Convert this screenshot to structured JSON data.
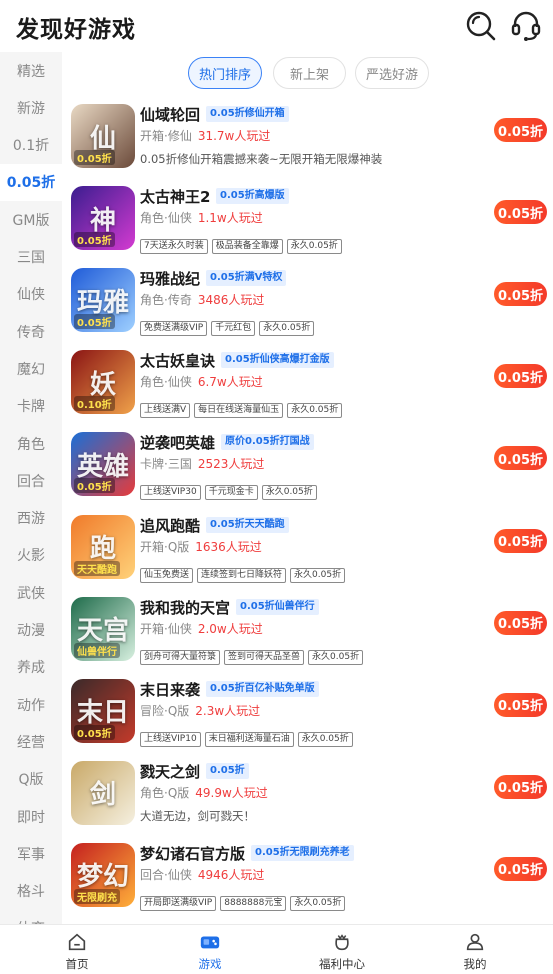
{
  "header": {
    "title": "发现好游戏",
    "search_icon": "search-icon",
    "service_icon": "headset-icon"
  },
  "sidebar": {
    "active_color": "#1e6fe8",
    "items": [
      {
        "label": "精选"
      },
      {
        "label": "新游"
      },
      {
        "label": "0.1折"
      },
      {
        "label": "0.05折",
        "active": true
      },
      {
        "label": "GM版"
      },
      {
        "label": "三国"
      },
      {
        "label": "仙侠"
      },
      {
        "label": "传奇"
      },
      {
        "label": "魔幻"
      },
      {
        "label": "卡牌"
      },
      {
        "label": "角色"
      },
      {
        "label": "回合"
      },
      {
        "label": "西游"
      },
      {
        "label": "火影"
      },
      {
        "label": "武侠"
      },
      {
        "label": "动漫"
      },
      {
        "label": "养成"
      },
      {
        "label": "动作"
      },
      {
        "label": "经营"
      },
      {
        "label": "Q版"
      },
      {
        "label": "即时"
      },
      {
        "label": "军事"
      },
      {
        "label": "格斗"
      },
      {
        "label": "体育"
      }
    ]
  },
  "tabs": [
    {
      "label": "热门排序",
      "active": true
    },
    {
      "label": "新上架"
    },
    {
      "label": "严选好游"
    }
  ],
  "games": [
    {
      "name": "仙域轮回",
      "badge": "0.05折修仙开箱",
      "genre": "开箱·修仙",
      "players": "31.7w人玩过",
      "desc": "0.05折修仙开箱震撼来袭~无限开箱无限爆神装",
      "chips": [],
      "discount": "0.05折",
      "icon_text": "仙",
      "icon_tag": "0.05折",
      "icon_colors": [
        "#e9d9c4",
        "#6b4a3a"
      ]
    },
    {
      "name": "太古神王2",
      "badge": "0.05折高爆版",
      "genre": "角色·仙侠",
      "players": "1.1w人玩过",
      "desc": "",
      "chips": [
        "7天送永久时装",
        "极品装备全靠爆",
        "永久0.05折"
      ],
      "discount": "0.05折",
      "icon_text": "神",
      "icon_tag": "0.05折",
      "icon_colors": [
        "#3a1d8f",
        "#d43bd1"
      ]
    },
    {
      "name": "玛雅战纪",
      "badge": "0.05折满V特权",
      "genre": "角色·传奇",
      "players": "3486人玩过",
      "desc": "",
      "chips": [
        "免费送满级VIP",
        "千元红包",
        "永久0.05折"
      ],
      "discount": "0.05折",
      "icon_text": "玛雅",
      "icon_tag": "0.05折",
      "icon_colors": [
        "#1f5bd8",
        "#9fd0ff"
      ]
    },
    {
      "name": "太古妖皇诀",
      "badge": "0.05折仙侠高爆打金版",
      "genre": "角色·仙侠",
      "players": "6.7w人玩过",
      "desc": "",
      "chips": [
        "上线送满V",
        "每日在线送海量仙玉",
        "永久0.05折"
      ],
      "discount": "0.05折",
      "icon_text": "妖",
      "icon_tag": "0.10折",
      "icon_colors": [
        "#8a1414",
        "#f0a24a"
      ]
    },
    {
      "name": "逆袭吧英雄",
      "badge": "原价0.05折打国战",
      "genre": "卡牌·三国",
      "players": "2523人玩过",
      "desc": "",
      "chips": [
        "上线送VIP30",
        "千元现金卡",
        "永久0.05折"
      ],
      "discount": "0.05折",
      "icon_text": "英雄",
      "icon_tag": "0.05折",
      "icon_colors": [
        "#1a6fd6",
        "#e63b3b"
      ]
    },
    {
      "name": "追风跑酷",
      "badge": "0.05折天天酷跑",
      "genre": "开箱·Q版",
      "players": "1636人玩过",
      "desc": "",
      "chips": [
        "仙玉免费送",
        "连续签到七日降妖符",
        "永久0.05折"
      ],
      "discount": "0.05折",
      "icon_text": "跑",
      "icon_tag": "天天酷跑",
      "icon_colors": [
        "#f07a2a",
        "#ffd27a"
      ]
    },
    {
      "name": "我和我的天宫",
      "badge": "0.05折仙兽伴行",
      "genre": "开箱·仙侠",
      "players": "2.0w人玩过",
      "desc": "",
      "chips": [
        "剑舟可得大量符箓",
        "签到可得天品圣兽",
        "永久0.05折"
      ],
      "discount": "0.05折",
      "icon_text": "天宫",
      "icon_tag": "仙兽伴行",
      "icon_colors": [
        "#1e6b4a",
        "#d8f0e0"
      ]
    },
    {
      "name": "末日来袭",
      "badge": "0.05折百亿补贴免单版",
      "genre": "冒险·Q版",
      "players": "2.3w人玩过",
      "desc": "",
      "chips": [
        "上线送VIP10",
        "末日福利送海量石油",
        "永久0.05折"
      ],
      "discount": "0.05折",
      "icon_text": "末日",
      "icon_tag": "0.05折",
      "icon_colors": [
        "#3a2a2a",
        "#c43a2a"
      ]
    },
    {
      "name": "戮天之剑",
      "badge": "0.05折",
      "genre": "角色·Q版",
      "players": "49.9w人玩过",
      "desc": "大道无边，剑可戮天！",
      "chips": [],
      "discount": "0.05折",
      "icon_text": "剑",
      "icon_tag": "",
      "icon_colors": [
        "#c9a968",
        "#f5f0e0"
      ]
    },
    {
      "name": "梦幻诸石官方版",
      "badge": "0.05折无限刷充养老",
      "genre": "回合·仙侠",
      "players": "4946人玩过",
      "desc": "",
      "chips": [
        "开局即送满级VIP",
        "8888888元宝",
        "永久0.05折"
      ],
      "discount": "0.05折",
      "icon_text": "梦幻",
      "icon_tag": "无限刷充",
      "icon_colors": [
        "#c4201f",
        "#ffb03a"
      ]
    }
  ],
  "bottom_nav": [
    {
      "label": "首页",
      "icon": "home-icon"
    },
    {
      "label": "游戏",
      "icon": "gamepad-icon",
      "active": true
    },
    {
      "label": "福利中心",
      "icon": "gift-bag-icon"
    },
    {
      "label": "我的",
      "icon": "user-icon"
    }
  ]
}
